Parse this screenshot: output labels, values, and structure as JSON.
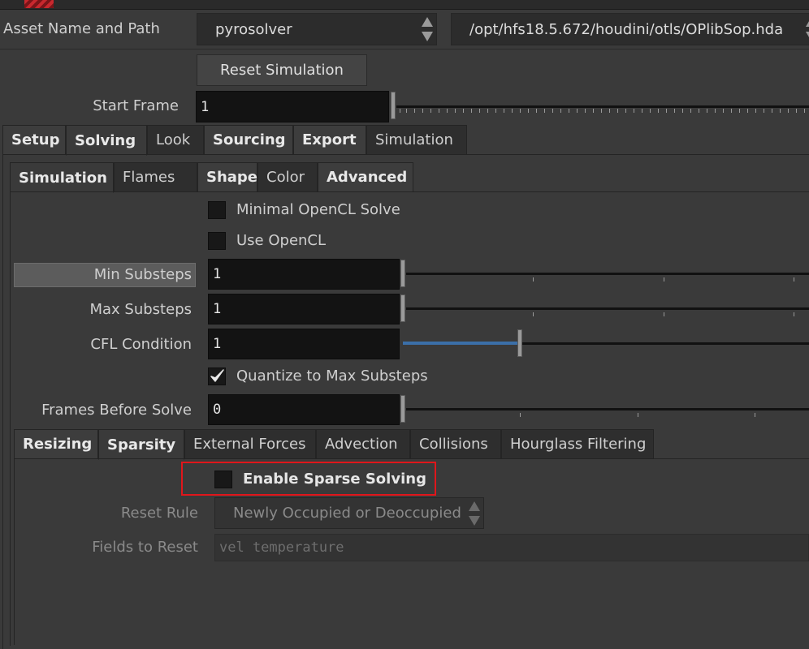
{
  "asset": {
    "label": "Asset Name and Path",
    "name": "pyrosolver",
    "path": "/opt/hfs18.5.672/houdini/otls/OPlibSop.hda"
  },
  "reset_simulation_label": "Reset Simulation",
  "start_frame": {
    "label": "Start Frame",
    "value": "1"
  },
  "main_tabs": [
    "Setup",
    "Solving",
    "Look",
    "Sourcing",
    "Export",
    "Simulation"
  ],
  "solving_tabs": [
    "Simulation",
    "Flames",
    "Shape",
    "Color",
    "Advanced"
  ],
  "simulation": {
    "minimal_opencl_label": "Minimal OpenCL Solve",
    "use_opencl_label": "Use OpenCL",
    "min_substeps": {
      "label": "Min Substeps",
      "value": "1"
    },
    "max_substeps": {
      "label": "Max Substeps",
      "value": "1"
    },
    "cfl_condition": {
      "label": "CFL Condition",
      "value": "1"
    },
    "quantize_label": "Quantize to Max Substeps",
    "quantize_checked": true,
    "frames_before_solve": {
      "label": "Frames Before Solve",
      "value": "0"
    }
  },
  "sub_tabs": [
    "Resizing",
    "Sparsity",
    "External Forces",
    "Advection",
    "Collisions",
    "Hourglass Filtering"
  ],
  "sparsity": {
    "enable_sparse_label": "Enable Sparse Solving",
    "enable_sparse_checked": false,
    "reset_rule": {
      "label": "Reset Rule",
      "value": "Newly Occupied or Deoccupied"
    },
    "fields_to_reset": {
      "label": "Fields to Reset",
      "value": "vel temperature"
    }
  },
  "colors": {
    "background": "#3a3a3a",
    "highlight_box": "#e0161b",
    "cfl_slider_fill": "#3b6fa8"
  }
}
